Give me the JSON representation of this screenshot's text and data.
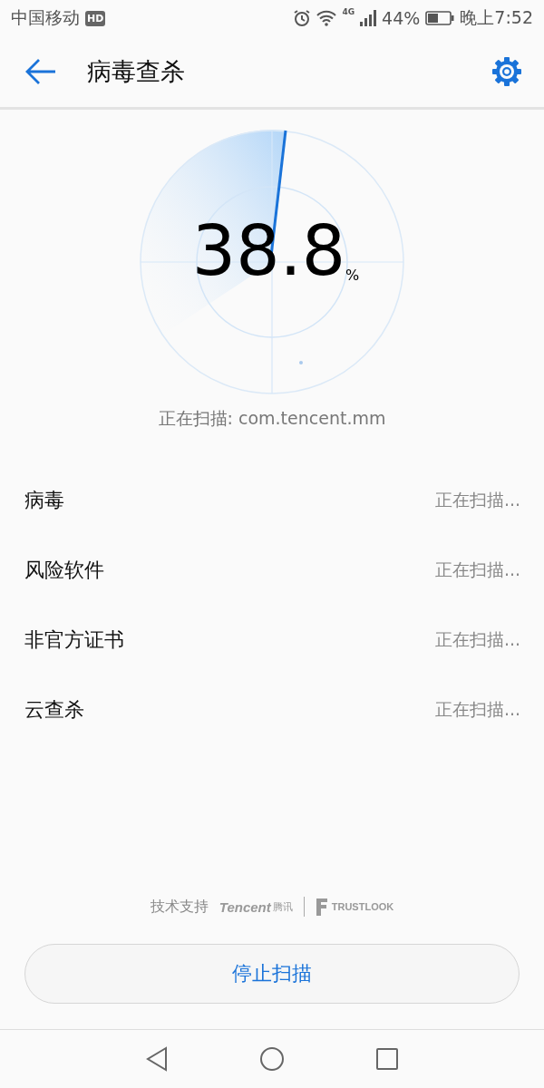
{
  "status_bar": {
    "carrier": "中国移动",
    "hd_badge": "HD",
    "network": "4G",
    "battery": "44%",
    "time": "晚上7:52"
  },
  "app_bar": {
    "title": "病毒查杀"
  },
  "scan": {
    "percent": "38.8",
    "unit": "%",
    "current": "正在扫描: com.tencent.mm"
  },
  "items": [
    {
      "label": "病毒",
      "status": "正在扫描..."
    },
    {
      "label": "风险软件",
      "status": "正在扫描..."
    },
    {
      "label": "非官方证书",
      "status": "正在扫描..."
    },
    {
      "label": "云查杀",
      "status": "正在扫描..."
    }
  ],
  "footer": {
    "support": "技术支持",
    "partner_1": "Tencent",
    "partner_1_cn": "腾讯",
    "partner_2": "TRUSTLOOK"
  },
  "stop_button": "停止扫描"
}
